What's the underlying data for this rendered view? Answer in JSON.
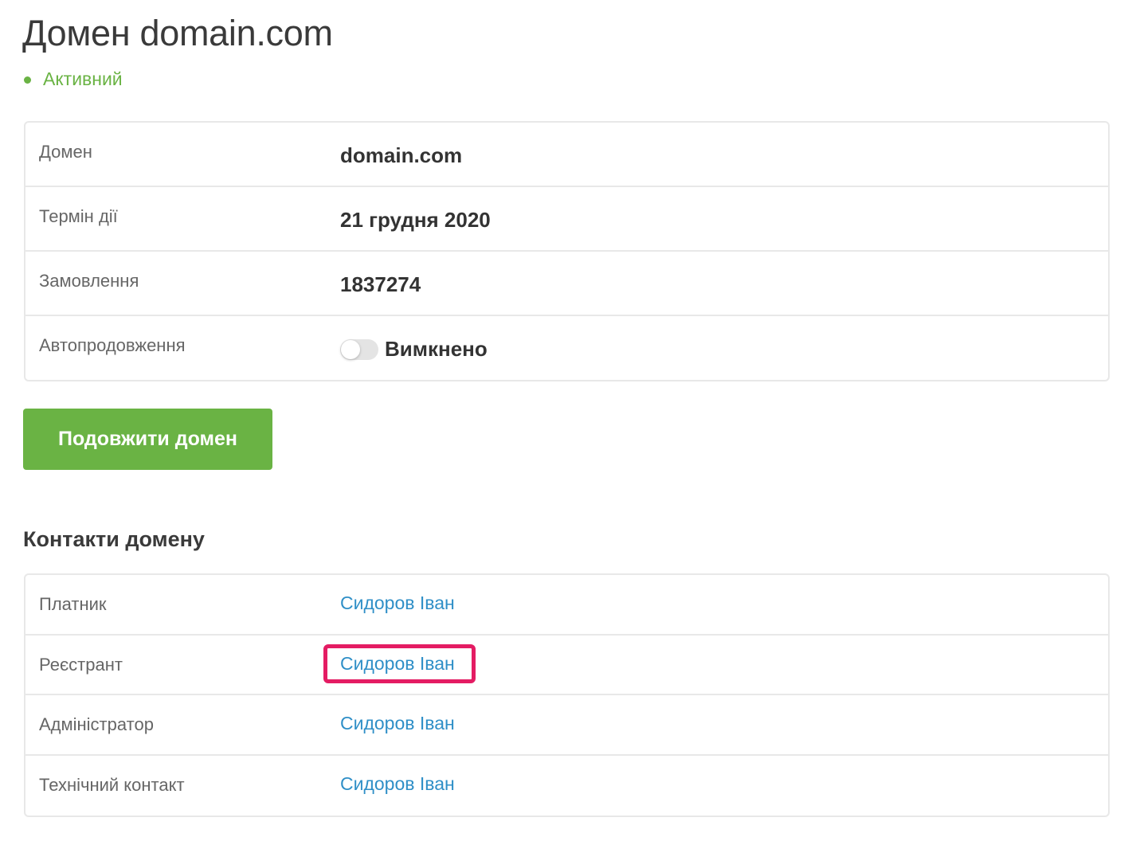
{
  "page": {
    "title": "Домен domain.com",
    "status": {
      "label": "Активний",
      "color": "#6ab344"
    }
  },
  "details": {
    "rows": [
      {
        "label": "Домен",
        "value": "domain.com"
      },
      {
        "label": "Термін дії",
        "value": "21 грудня 2020"
      },
      {
        "label": "Замовлення",
        "value": "1837274"
      },
      {
        "label": "Автопродовження",
        "value": "Вимкнено",
        "toggle_on": false
      }
    ]
  },
  "actions": {
    "renew_label": "Подовжити домен",
    "renew_color": "#6ab344"
  },
  "contacts": {
    "title": "Контакти домену",
    "rows": [
      {
        "label": "Платник",
        "value": "Сидоров Іван"
      },
      {
        "label": "Реєстрант",
        "value": "Сидоров Іван",
        "highlighted": true
      },
      {
        "label": "Адміністратор",
        "value": "Сидоров Іван"
      },
      {
        "label": "Технічний контакт",
        "value": "Сидоров Іван"
      }
    ],
    "link_color": "#2f8fc7",
    "highlight_color": "#e41c63"
  }
}
